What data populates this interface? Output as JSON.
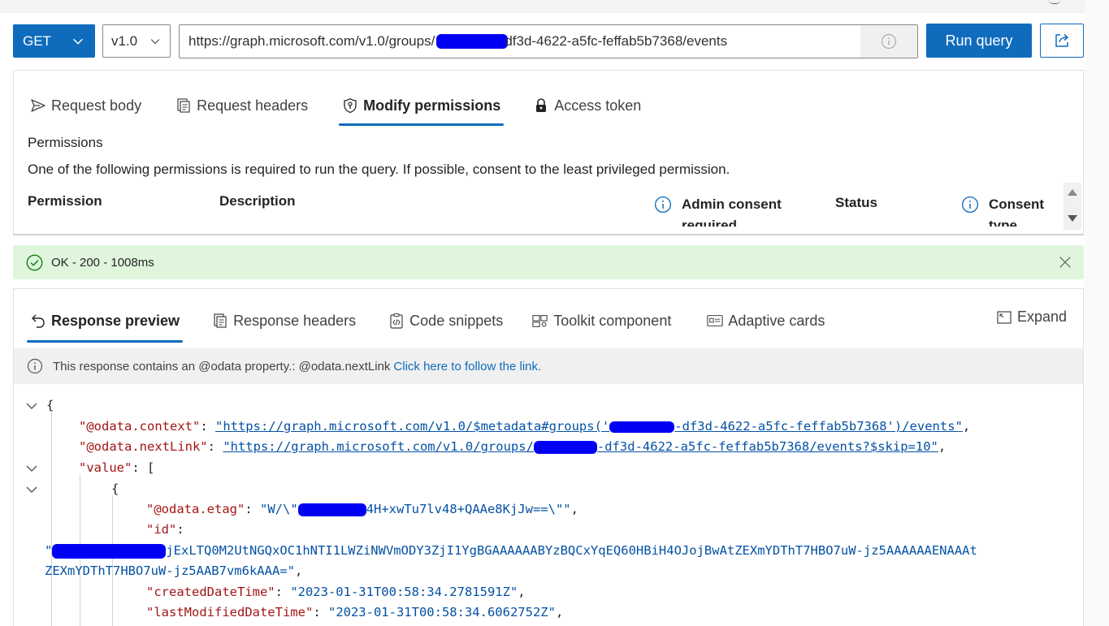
{
  "query": {
    "method": "GET",
    "version": "v1.0",
    "url_prefix": "https://graph.microsoft.com/v1.0/groups/",
    "url_suffix": "df3d-4622-a5fc-feffab5b7368/events",
    "run_label": "Run query"
  },
  "request_tabs": [
    {
      "label": "Request body",
      "icon": "send-icon"
    },
    {
      "label": "Request headers",
      "icon": "document-icon"
    },
    {
      "label": "Modify permissions",
      "icon": "shield-key-icon",
      "active": true
    },
    {
      "label": "Access token",
      "icon": "lock-icon"
    }
  ],
  "permissions": {
    "heading": "Permissions",
    "description": "One of the following permissions is required to run the query. If possible, consent to the least privileged permission.",
    "columns": {
      "permission": "Permission",
      "description": "Description",
      "admin_consent": "Admin consent required",
      "status": "Status",
      "consent_type": "Consent type"
    }
  },
  "status": {
    "text": "OK - 200 - 1008ms",
    "color": "#dff6dd"
  },
  "response_tabs": [
    {
      "label": "Response preview",
      "icon": "undo-arrow-icon",
      "active": true
    },
    {
      "label": "Response headers",
      "icon": "document-icon"
    },
    {
      "label": "Code snippets",
      "icon": "code-clipboard-icon"
    },
    {
      "label": "Toolkit component",
      "icon": "toolkit-icon"
    },
    {
      "label": "Adaptive cards",
      "icon": "card-icon"
    }
  ],
  "expand_label": "Expand",
  "notice": {
    "text": "This response contains an @odata property.: @odata.nextLink",
    "link": "Click here to follow the link."
  },
  "json": {
    "open_brace": "{",
    "context_key": "\"@odata.context\"",
    "context_val_a": "\"https://graph.microsoft.com/v1.0/$metadata#groups('",
    "context_val_b": "-df3d-4622-a5fc-feffab5b7368')/events\"",
    "nextlink_key": "\"@odata.nextLink\"",
    "nextlink_val_a": "\"https://graph.microsoft.com/v1.0/groups/",
    "nextlink_val_b": "-df3d-4622-a5fc-feffab5b7368/events?$skip=10\"",
    "value_key": "\"value\"",
    "value_open": "[",
    "item_open": "{",
    "etag_key": "\"@odata.etag\"",
    "etag_val_a": "\"W/\\\"",
    "etag_val_b": "4H+xwTu7lv48+QAAe8KjJw==\\\"\"",
    "id_key": "\"id\"",
    "id_val_a": "\"",
    "id_val_b": "jExLTQ0M2UtNGQxOC1hNTI1LWZiNWVmODY3ZjI1YgBGAAAAAABYzBQCxYqEQ60HBiH4OJojBwAtZEXmYDThT7HBO7uW-jz5AAAAAAENAAAt",
    "id_val_c": "ZEXmYDThT7HBO7uW-jz5AAB7vm6kAAA=\"",
    "created_key": "\"createdDateTime\"",
    "created_val": "\"2023-01-31T00:58:34.2781591Z\"",
    "modified_key": "\"lastModifiedDateTime\"",
    "modified_val": "\"2023-01-31T00:58:34.6062752Z\""
  }
}
